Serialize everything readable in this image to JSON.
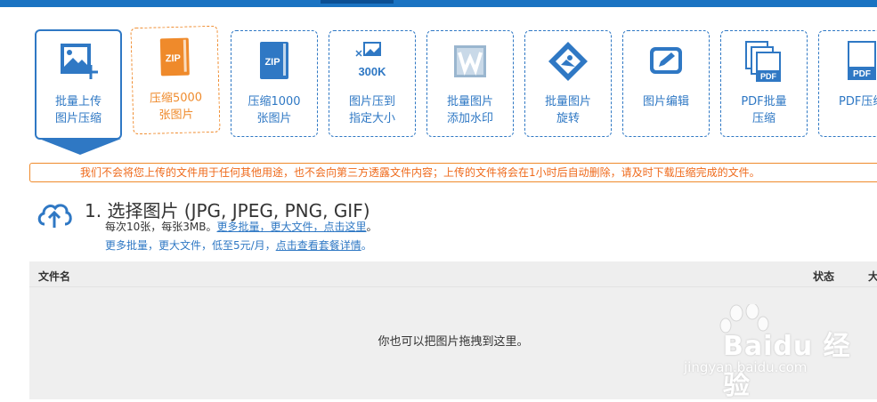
{
  "tools": [
    {
      "line1": "批量上传",
      "line2": "图片压缩",
      "icon": "image-upload-icon",
      "active": true
    },
    {
      "line1": "压缩5000",
      "line2": "张图片",
      "icon": "zip-orange-icon"
    },
    {
      "line1": "压缩1000",
      "line2": "张图片",
      "icon": "zip-blue-icon"
    },
    {
      "line1": "图片压到",
      "line2": "指定大小",
      "icon": "compress-300k-icon",
      "icon_text": "300K"
    },
    {
      "line1": "批量图片",
      "line2": "添加水印",
      "icon": "watermark-w-icon"
    },
    {
      "line1": "批量图片",
      "line2": "旋转",
      "icon": "rotate-image-icon"
    },
    {
      "line1": "图片编辑",
      "line2": "",
      "icon": "edit-image-icon"
    },
    {
      "line1": "PDF批量",
      "line2": "压缩",
      "icon": "pdf-stack-icon"
    },
    {
      "line1": "PDF压缩",
      "line2": "",
      "icon": "pdf-icon"
    }
  ],
  "notice": "我们不会将您上传的文件用于任何其他用途，也不会向第三方透露文件内容；上传的文件将会在1小时后自动删除，请及时下载压缩完成的文件。",
  "step": {
    "title": "1. 选择图片 (JPG, JPEG, PNG, GIF)",
    "line1_text": "每次10张，每张3MB。",
    "line1_link": "更多批量，更大文件，点击这里",
    "line1_end": "。",
    "line2_text": "更多批量，更大文件，低至5元/月，",
    "line2_link": "点击查看套餐详情",
    "line2_end": "。"
  },
  "table": {
    "col_name": "文件名",
    "col_status": "状态",
    "col_size": "大"
  },
  "dropzone_text": "你也可以把图片拖拽到这里。",
  "watermark": {
    "text": "Baidu 经验",
    "url": "jingyan.baidu.com"
  },
  "colors": {
    "accent": "#2f78c4",
    "orange": "#ef8a2b",
    "topbar": "#1a73c2"
  }
}
